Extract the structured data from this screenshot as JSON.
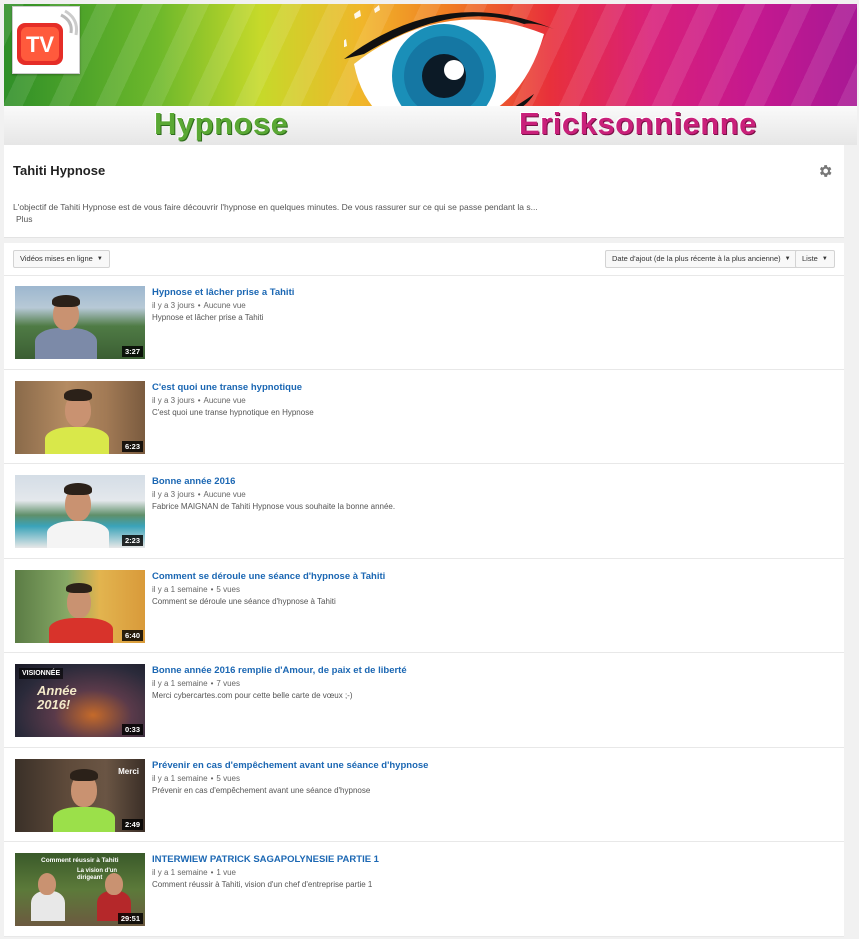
{
  "banner": {
    "logo_text": "TV",
    "word_left": "Hypnose",
    "word_right": "Ericksonnienne"
  },
  "channel": {
    "title": "Tahiti Hypnose",
    "description": "L'objectif de Tahiti Hypnose est de vous faire découvrir l'hypnose en quelques minutes. De vous rassurer sur ce qui se passe pendant la s...",
    "more_label": "Plus"
  },
  "toolbar": {
    "uploads_label": "Vidéos mises en ligne",
    "sort_label": "Date d'ajout (de la plus récente à la plus ancienne)",
    "view_label": "Liste"
  },
  "videos": [
    {
      "title": "Hypnose et lâcher prise a Tahiti",
      "age": "il y a 3 jours",
      "views": "Aucune vue",
      "description": "Hypnose et lâcher prise a Tahiti",
      "duration": "3:27"
    },
    {
      "title": "C'est quoi une transe hypnotique",
      "age": "il y a 3 jours",
      "views": "Aucune vue",
      "description": "C'est quoi une transe hypnotique en Hypnose",
      "duration": "6:23"
    },
    {
      "title": "Bonne année 2016",
      "age": "il y a 3 jours",
      "views": "Aucune vue",
      "description": "Fabrice MAIGNAN de Tahiti Hypnose vous souhaite la bonne année.",
      "duration": "2:23"
    },
    {
      "title": "Comment se déroule une séance d'hypnose à Tahiti",
      "age": "il y a 1 semaine",
      "views": "5 vues",
      "description": "Comment se déroule une séance d'hypnose à Tahiti",
      "duration": "6:40"
    },
    {
      "title": "Bonne année 2016 remplie d'Amour, de paix et de liberté",
      "age": "il y a 1 semaine",
      "views": "7 vues",
      "description": "Merci cybercartes.com pour cette belle carte de vœux ;-)",
      "duration": "0:33",
      "overlay": "VISIONNÉE",
      "overlay2": "Année 2016!"
    },
    {
      "title": "Prévenir en cas d'empêchement avant une séance d'hypnose",
      "age": "il y a 1 semaine",
      "views": "5 vues",
      "description": "Prévenir en cas d'empêchement avant une séance d'hypnose",
      "duration": "2:49",
      "overlay": "Merci"
    },
    {
      "title": "INTERWIEW PATRICK SAGAPOLYNESIE PARTIE 1",
      "age": "il y a 1 semaine",
      "views": "1 vue",
      "description": "Comment réussir à Tahiti, vision d'un chef d'entreprise partie 1",
      "duration": "29:51",
      "overlay": "Comment réussir à Tahiti",
      "overlay2": "La vision d'un dirigeant"
    }
  ],
  "meta_separator": "•",
  "colors": {
    "link_blue": "#1b67b3",
    "duration_bg": "#000000"
  }
}
